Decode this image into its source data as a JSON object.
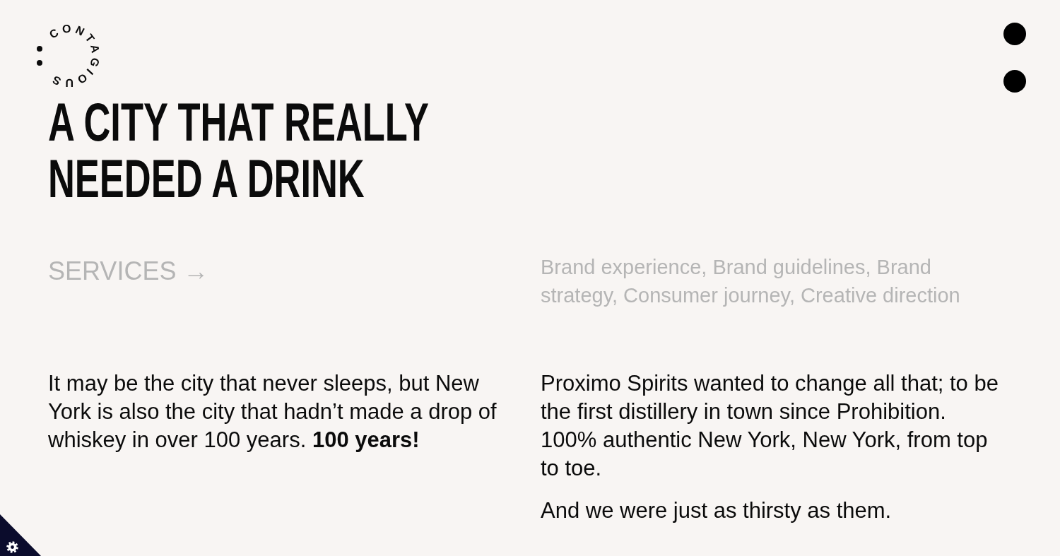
{
  "logo": {
    "text": "CONTAGIOUS"
  },
  "title": "A CITY THAT REALLY NEEDED A DRINK",
  "services": {
    "label": "SERVICES →",
    "list": "Brand experience, Brand guidelines, Brand strategy, Consumer journey, Creative direction"
  },
  "columns": [
    {
      "paragraphs": [
        "It may be the city that never sleeps, but New York is also the city that hadn’t made a drop of whiskey in over 100 years. **100 years!**"
      ]
    },
    {
      "paragraphs": [
        "Proximo Spirits wanted to change all that; to be the first distillery in town since Prohibition. 100% authentic New York, New York, from top to toe.",
        "And we were just as thirsty as them."
      ]
    }
  ]
}
